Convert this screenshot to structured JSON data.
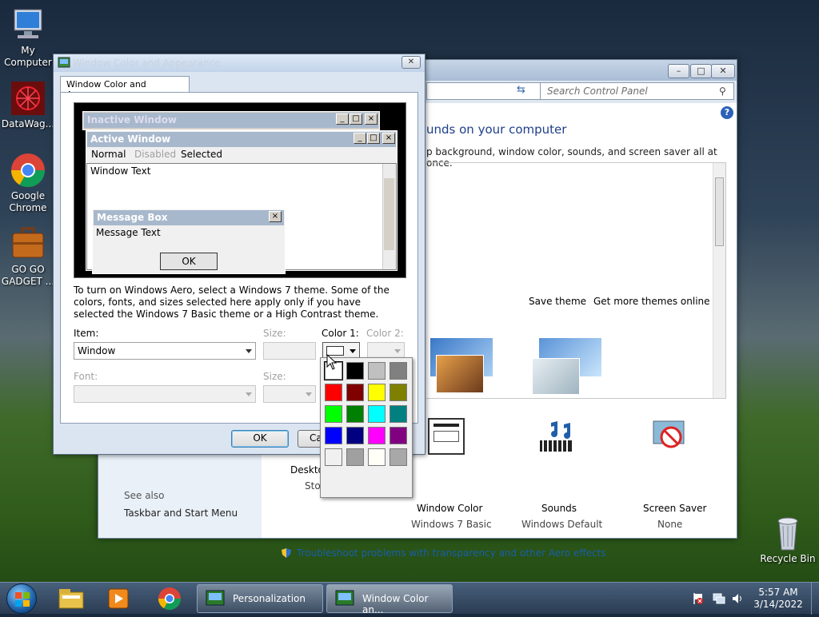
{
  "desktop": {
    "icons": [
      {
        "label": "My Computer",
        "icon": "computer-icon"
      },
      {
        "label": "DataWag...",
        "icon": "datawag-icon"
      },
      {
        "label": "Google Chrome",
        "icon": "chrome-icon"
      },
      {
        "label": "GO GO GADGET ...",
        "icon": "briefcase-icon"
      },
      {
        "label": "Recycle Bin",
        "icon": "recycle-bin-icon"
      }
    ]
  },
  "personalization": {
    "search_placeholder": "Search Control Panel",
    "heading": "unds on your computer",
    "subheading": "p background, window color, sounds, and screen saver all at once.",
    "save_theme": "Save theme",
    "more_themes": "Get more themes online",
    "bottom_items": [
      {
        "label": "Desktop",
        "sub": "Stor"
      },
      {
        "label": "Window Color",
        "sub": "Windows 7 Basic"
      },
      {
        "label": "Sounds",
        "sub": "Windows Default"
      },
      {
        "label": "Screen Saver",
        "sub": "None"
      }
    ],
    "see_also": "See also",
    "taskbar_link": "Taskbar and Start Menu",
    "troubleshoot": "Troubleshoot problems with transparency and other Aero effects"
  },
  "dialog": {
    "title": "Window Color and Appearance",
    "tab": "Window Color and Appearance",
    "preview": {
      "inactive_title": "Inactive Window",
      "active_title": "Active Window",
      "menu": [
        "Normal",
        "Disabled",
        "Selected"
      ],
      "window_text": "Window Text",
      "msgbox_title": "Message Box",
      "msgbox_text": "Message Text",
      "ok": "OK"
    },
    "info_text": "To turn on Windows Aero, select a Windows 7 theme.  Some of the colors, fonts, and sizes selected here apply only if you have selected the Windows 7 Basic theme or a High Contrast theme.",
    "item_label": "Item:",
    "item_value": "Window",
    "size_label": "Size:",
    "color1_label": "Color 1:",
    "color2_label": "Color 2:",
    "font_label": "Font:",
    "size2_label": "Size:",
    "ok_button": "OK",
    "cancel_button": "Ca"
  },
  "palette": {
    "colors": [
      "#ffffff",
      "#000000",
      "#c0c0c0",
      "#808080",
      "#ff0000",
      "#800000",
      "#ffff00",
      "#808000",
      "#00ff00",
      "#008000",
      "#00ffff",
      "#008080",
      "#0000ff",
      "#000080",
      "#ff00ff",
      "#800080",
      "#f0f0f0",
      "#a0a0a0",
      "#fffff8",
      "#a8a8a8"
    ]
  },
  "taskbar": {
    "personalization": "Personalization",
    "window_color": "Window Color an...",
    "time": "5:57 AM",
    "date": "3/14/2022"
  }
}
